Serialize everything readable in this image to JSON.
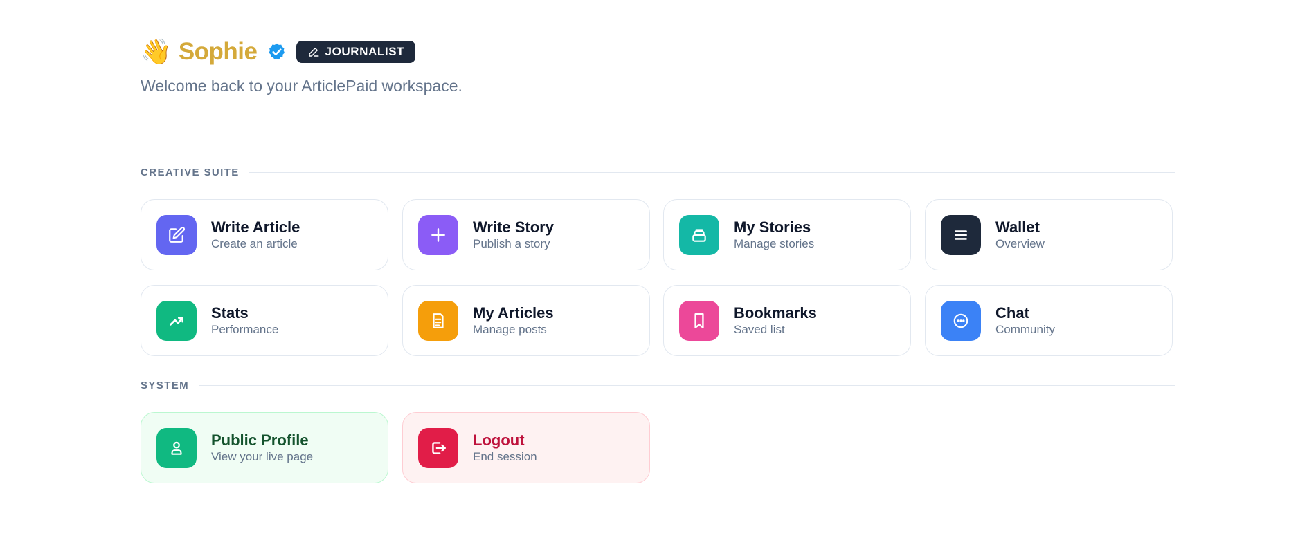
{
  "header": {
    "wave": "👋",
    "name": "Sophie",
    "role_badge": "JOURNALIST",
    "subtitle": "Welcome back to your ArticlePaid workspace."
  },
  "sections": {
    "creative": "CREATIVE SUITE",
    "system": "SYSTEM"
  },
  "creative_cards": [
    {
      "title": "Write Article",
      "subtitle": "Create an article",
      "color": "#6366f1",
      "icon": "edit-icon"
    },
    {
      "title": "Write Story",
      "subtitle": "Publish a story",
      "color": "#8b5cf6",
      "icon": "plus-icon"
    },
    {
      "title": "My Stories",
      "subtitle": "Manage stories",
      "color": "#14b8a6",
      "icon": "stack-icon"
    },
    {
      "title": "Wallet",
      "subtitle": "Overview",
      "color": "#1e293b",
      "icon": "menu-icon"
    },
    {
      "title": "Stats",
      "subtitle": "Performance",
      "color": "#10b981",
      "icon": "trending-up-icon"
    },
    {
      "title": "My Articles",
      "subtitle": "Manage posts",
      "color": "#f59e0b",
      "icon": "document-icon"
    },
    {
      "title": "Bookmarks",
      "subtitle": "Saved list",
      "color": "#ec4899",
      "icon": "bookmark-icon"
    },
    {
      "title": "Chat",
      "subtitle": "Community",
      "color": "#3b82f6",
      "icon": "chat-icon"
    }
  ],
  "system_cards": [
    {
      "title": "Public Profile",
      "subtitle": "View your live page",
      "color": "#10b981",
      "icon": "user-icon"
    },
    {
      "title": "Logout",
      "subtitle": "End session",
      "color": "#e11d48",
      "icon": "logout-icon"
    }
  ]
}
